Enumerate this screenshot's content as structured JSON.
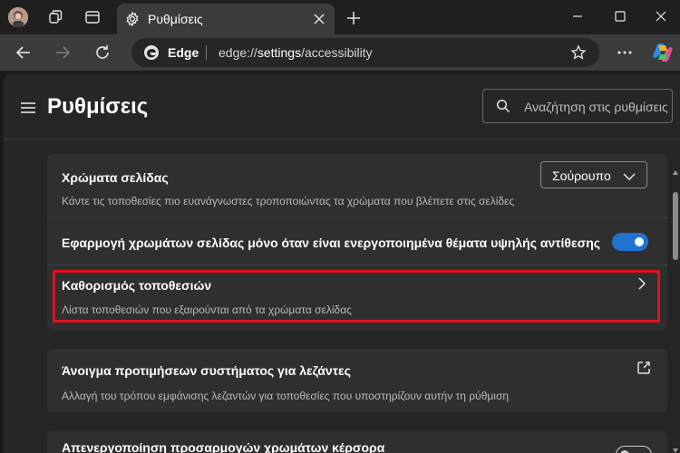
{
  "tab": {
    "title": "Ρυθμίσεις"
  },
  "address": {
    "brand": "Edge",
    "url_prefix": "edge://",
    "url_host": "settings",
    "url_path": "/accessibility"
  },
  "page": {
    "title": "Ρυθμίσεις",
    "search_placeholder": "Αναζήτηση στις ρυθμίσεις"
  },
  "page_colors": {
    "title": "Χρώματα σελίδας",
    "description": "Κάντε τις τοποθεσίες πιο ευανάγνωστες τροποποιώντας τα χρώματα που βλέπετε στις σελίδες",
    "selected": "Σούρουπο"
  },
  "high_contrast": {
    "title": "Εφαρμογή χρωμάτων σελίδας μόνο όταν είναι ενεργοποιημένα θέματα υψηλής αντίθεσης",
    "enabled": true
  },
  "customize_sites": {
    "title": "Καθορισμός τοποθεσιών",
    "description": "Λίστα τοποθεσιών που εξαιρούνται από τα χρώματα σελίδας"
  },
  "captions": {
    "title": "Άνοιγμα προτιμήσεων συστήματος για λεζάντες",
    "description": "Αλλαγή του τρόπου εμφάνισης λεζαντών για τοποθεσίες που υποστηρίζουν αυτήν τη ρύθμιση"
  },
  "partial_row": {
    "title": "Απενεργοποίηση προσαρμογών χρωμάτων κέρσορα",
    "enabled": false
  },
  "colors": {
    "accent": "#1f73d0",
    "highlight": "#e3101c",
    "background": "#262626",
    "card": "#2f2f2f"
  }
}
